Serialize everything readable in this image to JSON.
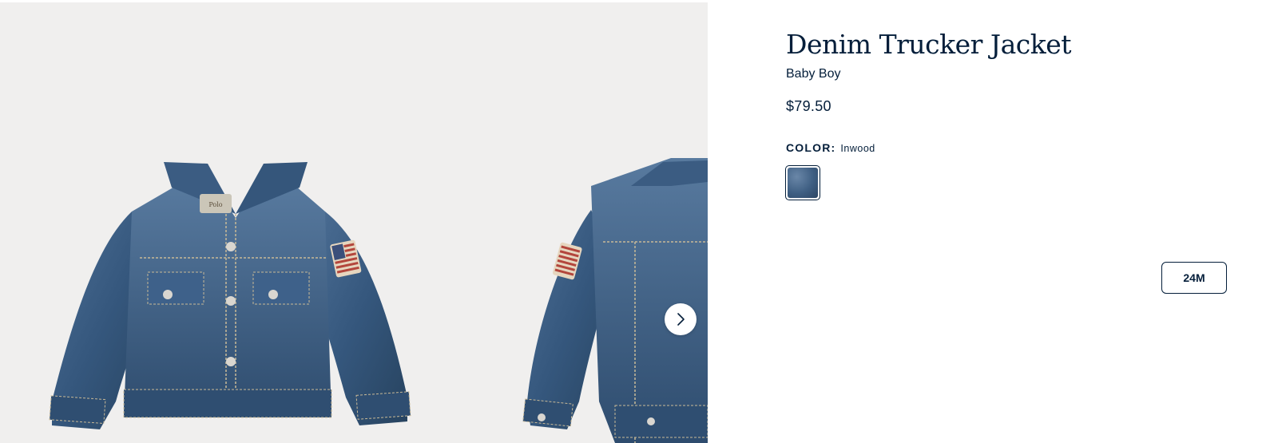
{
  "product": {
    "title": "Denim Trucker Jacket",
    "category": "Baby Boy",
    "price": "$79.50"
  },
  "color": {
    "label": "COLOR:",
    "selected": "Inwood",
    "swatch_color": "#4a6a8f"
  },
  "sizes": [
    {
      "label": "24M"
    }
  ],
  "gallery": {
    "background": "#f0efee",
    "next_icon": "chevron-right-icon",
    "images": [
      "denim-jacket-front",
      "denim-jacket-back"
    ]
  },
  "colors": {
    "primary_text": "#041e3a",
    "denim": "#3d5f85"
  }
}
